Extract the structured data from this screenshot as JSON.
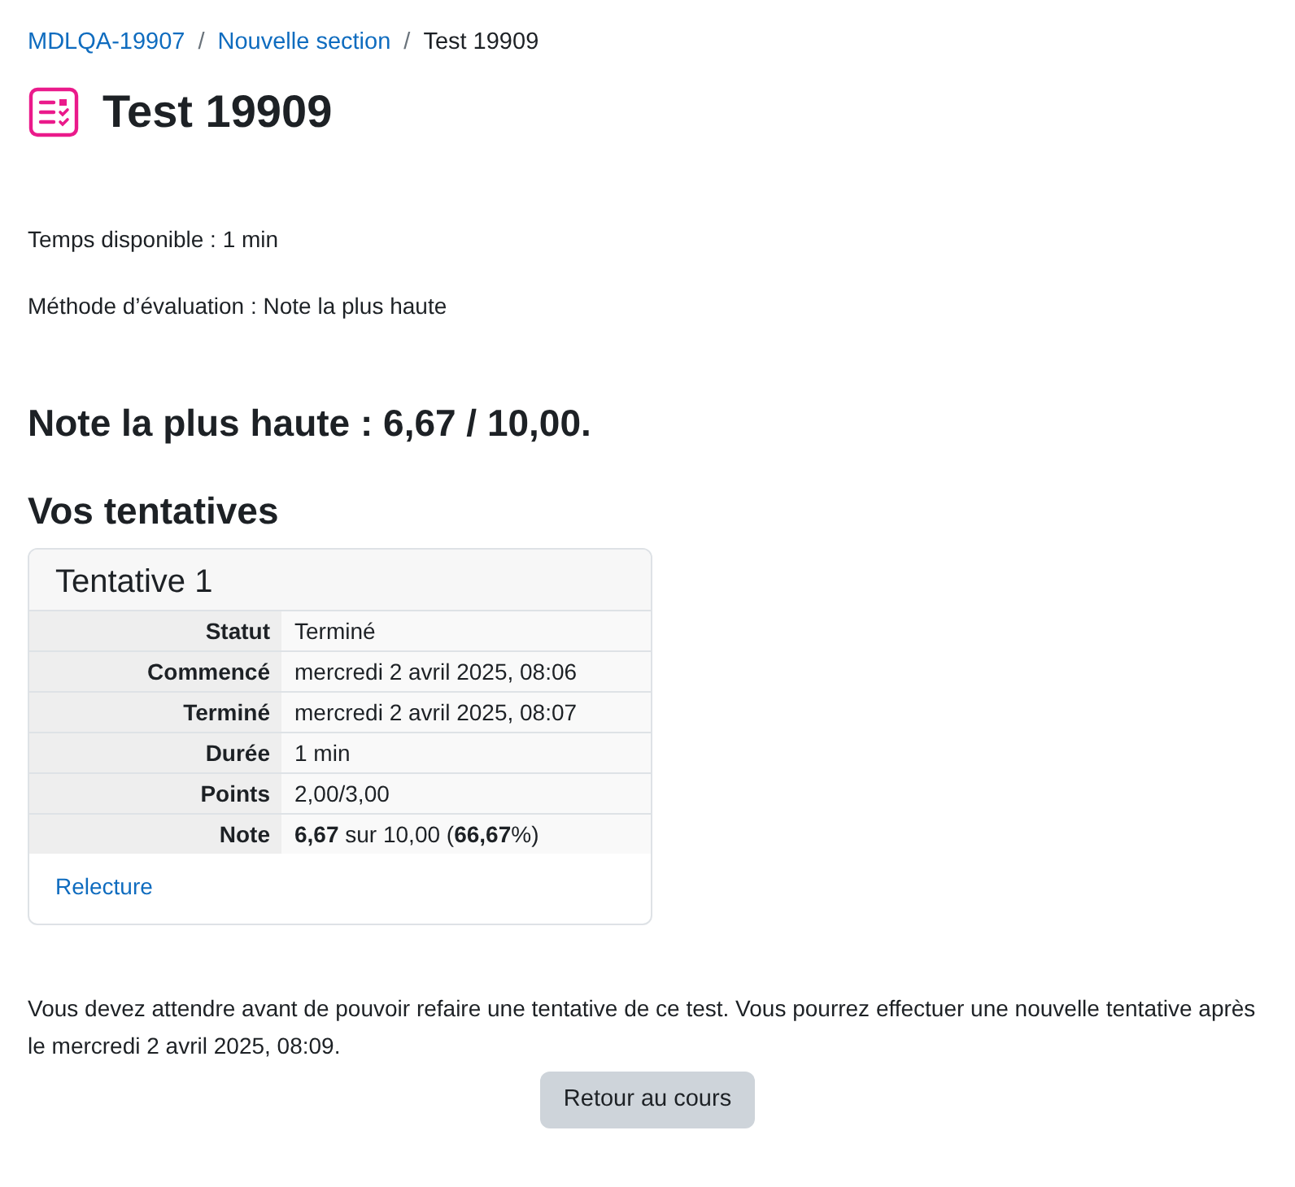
{
  "breadcrumb_separator": "/",
  "breadcrumb": [
    {
      "label": "MDLQA-19907",
      "link": true
    },
    {
      "label": "Nouvelle section",
      "link": true
    },
    {
      "label": "Test 19909",
      "link": false
    }
  ],
  "title": "Test 19909",
  "info": [
    "Temps disponible : 1 min",
    "Méthode d’évaluation : Note la plus haute"
  ],
  "highest_grade": "Note la plus haute : 6,67 / 10,00.",
  "attempts_heading": "Vos tentatives",
  "attempt": {
    "title": "Tentative 1",
    "rows": [
      {
        "label": "Statut",
        "value": "Terminé"
      },
      {
        "label": "Commencé",
        "value": "mercredi 2 avril 2025, 08:06"
      },
      {
        "label": "Terminé",
        "value": "mercredi 2 avril 2025, 08:07"
      },
      {
        "label": "Durée",
        "value": "1 min"
      },
      {
        "label": "Points",
        "value": "2,00/3,00"
      },
      {
        "label": "Note",
        "value": "**6,67** sur 10,00 (**66,67**%)"
      }
    ],
    "review_link": "Relecture"
  },
  "notice": "Vous devez attendre avant de pouvoir refaire une tentative de ce test. Vous pourrez effectuer une nouvelle tentative après le mercredi 2 avril 2025, 08:09.",
  "back_button": "Retour au cours"
}
